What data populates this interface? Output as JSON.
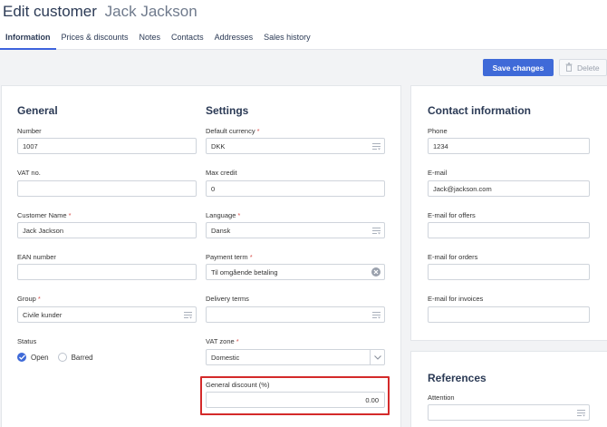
{
  "header": {
    "title": "Edit customer",
    "customer_name": "Jack Jackson",
    "tabs": [
      {
        "label": "Information",
        "active": true
      },
      {
        "label": "Prices & discounts",
        "active": false
      },
      {
        "label": "Notes",
        "active": false
      },
      {
        "label": "Contacts",
        "active": false
      },
      {
        "label": "Addresses",
        "active": false
      },
      {
        "label": "Sales history",
        "active": false
      }
    ]
  },
  "toolbar": {
    "save_label": "Save changes",
    "delete_label": "Delete"
  },
  "general": {
    "title": "General",
    "number": {
      "label": "Number",
      "value": "1007"
    },
    "vat_no": {
      "label": "VAT no.",
      "value": ""
    },
    "customer_name": {
      "label": "Customer Name",
      "value": "Jack Jackson",
      "required": true
    },
    "ean_number": {
      "label": "EAN number",
      "value": ""
    },
    "group": {
      "label": "Group",
      "value": "Civile kunder",
      "required": true
    },
    "status": {
      "label": "Status",
      "options": [
        "Open",
        "Barred"
      ],
      "selected": "Open"
    }
  },
  "settings": {
    "title": "Settings",
    "default_currency": {
      "label": "Default currency",
      "value": "DKK",
      "required": true
    },
    "max_credit": {
      "label": "Max credit",
      "value": "0"
    },
    "language": {
      "label": "Language",
      "value": "Dansk",
      "required": true
    },
    "payment_term": {
      "label": "Payment term",
      "value": "Til omgående betaling",
      "required": true
    },
    "delivery_terms": {
      "label": "Delivery terms",
      "value": ""
    },
    "vat_zone": {
      "label": "VAT zone",
      "value": "Domestic",
      "required": true
    },
    "general_discount": {
      "label": "General discount (%)",
      "value": "0.00"
    }
  },
  "contact": {
    "title": "Contact information",
    "phone": {
      "label": "Phone",
      "value": "1234"
    },
    "email": {
      "label": "E-mail",
      "value": "Jack@jackson.com"
    },
    "email_offers": {
      "label": "E-mail for offers",
      "value": ""
    },
    "email_orders": {
      "label": "E-mail for orders",
      "value": ""
    },
    "email_invoices": {
      "label": "E-mail for invoices",
      "value": ""
    }
  },
  "references": {
    "title": "References",
    "attention": {
      "label": "Attention",
      "value": ""
    }
  },
  "colors": {
    "accent": "#3f6ad8",
    "title": "#2b3a55",
    "required": "#d9534f",
    "highlight": "#d42a2a"
  }
}
